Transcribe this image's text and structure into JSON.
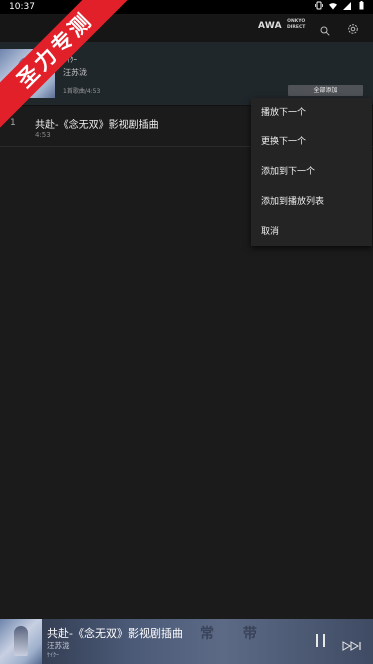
{
  "status": {
    "time": "10:37"
  },
  "appbar": {
    "awa": "AWA",
    "onkyo_line1": "ONKYO",
    "onkyo_line2": "DIRECT"
  },
  "album": {
    "title": "ｹｲｸｰ",
    "artist": "汪苏泷",
    "meta": "1首歌曲/4:53",
    "add_all": "全部添加"
  },
  "tracks": [
    {
      "number": "1",
      "title": "共赴-《念无双》影视剧插曲",
      "duration": "4:53"
    }
  ],
  "menu": {
    "items": [
      "播放下一个",
      "更换下一个",
      "添加到下一个",
      "添加到播放列表",
      "取消"
    ]
  },
  "watermark": {
    "text": "圣力专测"
  },
  "player": {
    "title": "共赴-《念无双》影视剧插曲",
    "artist": "汪苏泷",
    "album": "ｹｲｸｰ",
    "bg_text": "常 带"
  },
  "colors": {
    "watermark": "#e2202a",
    "header_bg": "#20272b",
    "menu_bg": "#242424",
    "app_bg": "#1b1b1b"
  }
}
